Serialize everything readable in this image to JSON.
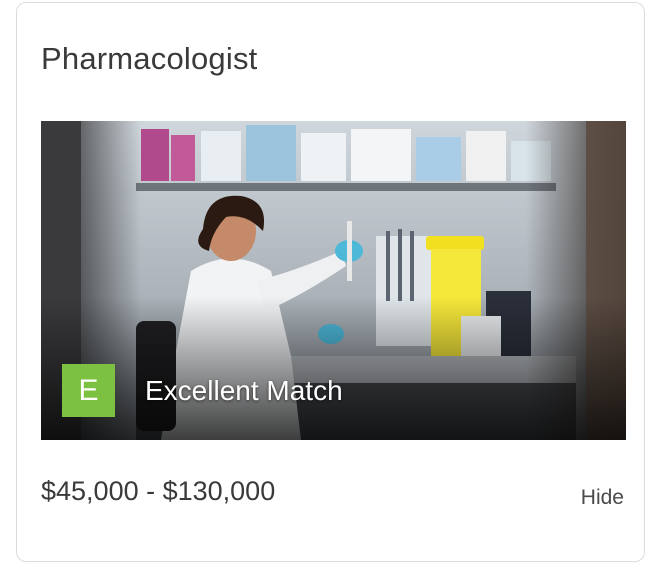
{
  "card": {
    "title": "Pharmacologist",
    "match": {
      "grade": "E",
      "label": "Excellent Match",
      "badge_color": "#7cc142"
    },
    "salary_range": "$45,000 - $130,000",
    "hide_label": "Hide"
  }
}
